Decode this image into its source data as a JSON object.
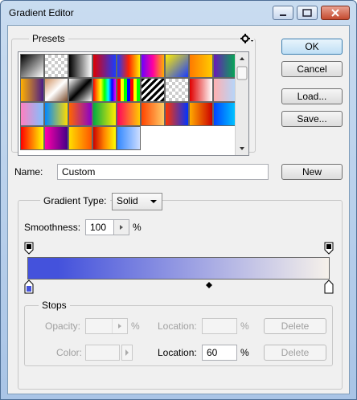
{
  "window": {
    "title": "Gradient Editor"
  },
  "presets": {
    "label": "Presets",
    "swatches": [
      "linear-gradient(135deg,#000,#fff)",
      "repeating-conic-gradient(#ccc 0 25%,#fff 0 50%) 0 0/8px 8px",
      "linear-gradient(90deg,#000,#fff)",
      "linear-gradient(90deg,#e00000,#1a3cff)",
      "linear-gradient(90deg,#1a3cff,#ff2200,#ffee00)",
      "linear-gradient(90deg,#6a00ff,#ff00a0,#ffb000)",
      "linear-gradient(135deg,#ffee00,#1a3cff)",
      "linear-gradient(90deg,#ff7a00,#ffcc00)",
      "linear-gradient(90deg,#6a1ab8,#00b050)",
      "linear-gradient(90deg,#ffb000,#4a1a8a)",
      "linear-gradient(135deg,#d09060,#fff,#7a4a2a)",
      "linear-gradient(135deg,#fff,#000 50%,#fff)",
      "linear-gradient(90deg,#ff0000,#ff8800,#ffff00,#00ff00,#00ffff,#0000ff,#ff00ff)",
      "repeating-linear-gradient(90deg,#f00 0 4px,#ff0 4px 8px,#0f0 8px 12px,#00f 12px 16px)",
      "repeating-linear-gradient(135deg,#000 0 3px,#fff 3px 6px)",
      "repeating-conic-gradient(#ccc 0 25%,#fff 0 50%) 0 0/8px 8px",
      "linear-gradient(90deg,#e00000,#ffffff)",
      "linear-gradient(90deg,#ffb0b0,#b0d8ff)",
      "linear-gradient(90deg,#ff80c0,#80c0ff)",
      "linear-gradient(90deg,#0088ff,#ffdd00)",
      "linear-gradient(90deg,#ff6600,#8800cc)",
      "linear-gradient(90deg,#00aa44,#ffee00)",
      "linear-gradient(90deg,#ff0060,#ffcc00)",
      "linear-gradient(90deg,#ff4400,#ffcc66)",
      "linear-gradient(90deg,#ff3300,#0033ff)",
      "linear-gradient(90deg,#ffaa00,#cc0000)",
      "linear-gradient(90deg,#0044ff,#00ccff)",
      "linear-gradient(90deg,#ff0000,#ffff00)",
      "linear-gradient(90deg,#ff00aa,#440088)",
      "linear-gradient(90deg,#ffdd00,#ff5500)",
      "linear-gradient(90deg,#cc0000,#ff8800,#ffff00)",
      "linear-gradient(90deg,#3388ff,#ccddff)"
    ]
  },
  "buttons": {
    "ok": "OK",
    "cancel": "Cancel",
    "load": "Load...",
    "save": "Save...",
    "new": "New",
    "delete": "Delete"
  },
  "name": {
    "label": "Name:",
    "value": "Custom"
  },
  "gradient": {
    "type_label": "Gradient Type:",
    "type_value": "Solid",
    "smoothness_label": "Smoothness:",
    "smoothness_value": "100",
    "percent": "%",
    "start_color": "#4452dc",
    "end_color": "#f6f1ea"
  },
  "stops": {
    "label": "Stops",
    "opacity_label": "Opacity:",
    "opacity_value": "",
    "opacity_unit": "%",
    "location_label": "Location:",
    "opacity_location_value": "",
    "location_unit": "%",
    "color_label": "Color:",
    "color_location_value": "60"
  }
}
